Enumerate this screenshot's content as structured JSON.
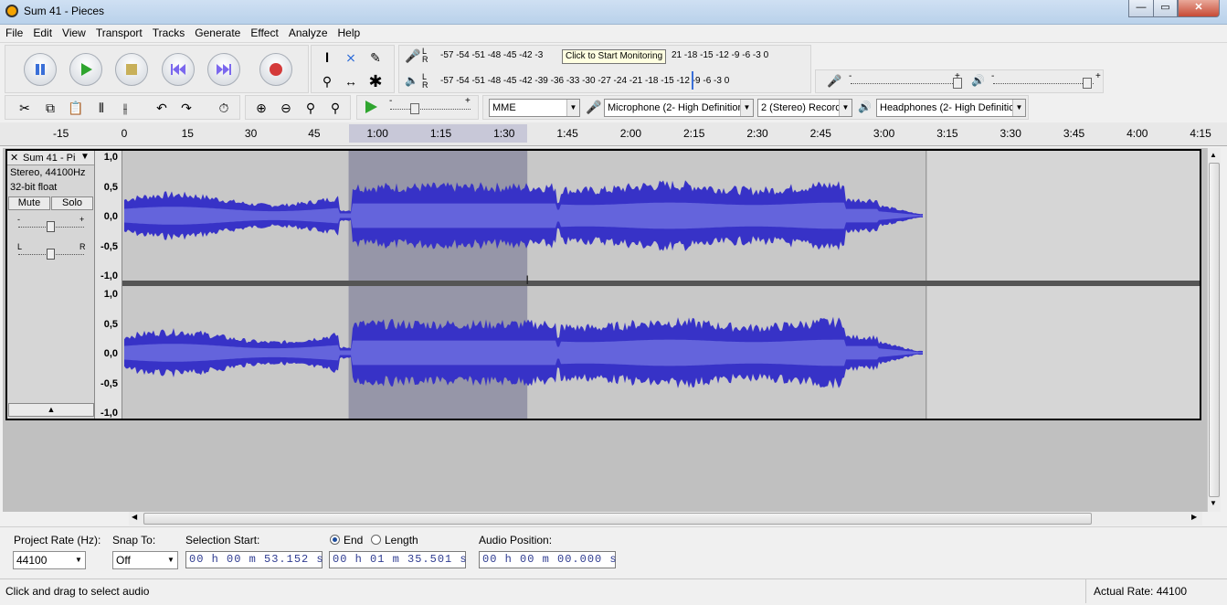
{
  "window": {
    "title": "Sum 41 - Pieces",
    "minimize": "—",
    "maximize": "▭",
    "close": "✕"
  },
  "menu": [
    "File",
    "Edit",
    "View",
    "Transport",
    "Tracks",
    "Generate",
    "Effect",
    "Analyze",
    "Help"
  ],
  "transport_icons": [
    "pause-icon",
    "play-icon",
    "stop-icon",
    "skip-to-start-icon",
    "skip-to-end-icon",
    "record-icon"
  ],
  "meters": {
    "record_scale": "-57 -54 -51 -48 -45 -42 -3",
    "record_scale_tail": "21 -18 -15 -12  -9  -6  -3  0",
    "tooltip": "Click to Start Monitoring",
    "play_scale": "-57 -54 -51 -48 -45 -42 -39 -36 -33 -30 -27 -24 -21 -18 -15 -12  -9  -6  -3  0",
    "L": "L",
    "R": "R"
  },
  "mixer": {
    "record_min": "-",
    "record_max": "+",
    "play_min": "-",
    "play_max": "+"
  },
  "device": {
    "host": "MME",
    "input": "Microphone (2- High Definitior",
    "channels": "2 (Stereo) Recorc",
    "output": "Headphones (2- High Definitic"
  },
  "play_speed": {
    "min": "-",
    "max": "+"
  },
  "ruler_ticks": [
    {
      "label": "-15",
      "v": -15
    },
    {
      "label": "0",
      "v": 0
    },
    {
      "label": "15",
      "v": 15
    },
    {
      "label": "30",
      "v": 30
    },
    {
      "label": "45",
      "v": 45
    },
    {
      "label": "1:00",
      "v": 60
    },
    {
      "label": "1:15",
      "v": 75
    },
    {
      "label": "1:30",
      "v": 90
    },
    {
      "label": "1:45",
      "v": 105
    },
    {
      "label": "2:00",
      "v": 120
    },
    {
      "label": "2:15",
      "v": 135
    },
    {
      "label": "2:30",
      "v": 150
    },
    {
      "label": "2:45",
      "v": 165
    },
    {
      "label": "3:00",
      "v": 180
    },
    {
      "label": "3:15",
      "v": 195
    },
    {
      "label": "3:30",
      "v": 210
    },
    {
      "label": "3:45",
      "v": 225
    },
    {
      "label": "4:00",
      "v": 240
    },
    {
      "label": "4:15",
      "v": 255
    }
  ],
  "track": {
    "name": "Sum 41 - Pi",
    "close": "✕",
    "format": "Stereo, 44100Hz",
    "bits": "32-bit float",
    "mute": "Mute",
    "solo": "Solo",
    "gain_min": "-",
    "gain_max": "+",
    "pan_left": "L",
    "pan_right": "R",
    "collapse": "▲",
    "duration_s": 190,
    "selection_start_s": 53.152,
    "selection_end_s": 95.501,
    "waveform_color": "#3732c7",
    "waveform_rms_color": "#6464dc",
    "selection_color": "#9696a8",
    "background_color": "#d6d6d6"
  },
  "vruler_labels": [
    "1,0",
    "0,5",
    "0,0",
    "-0,5",
    "-1,0"
  ],
  "selection": {
    "project_rate_label": "Project Rate (Hz):",
    "project_rate": "44100",
    "snap_label": "Snap To:",
    "snap": "Off",
    "start_label": "Selection Start:",
    "start_value": "00 h 00 m 53.152 s",
    "end_label": "End",
    "length_label": "Length",
    "end_value": "00 h 01 m 35.501 s",
    "audio_pos_label": "Audio Position:",
    "audio_pos_value": "00 h 00 m 00.000 s"
  },
  "status": {
    "left": "Click and drag to select audio",
    "right": "Actual Rate: 44100"
  }
}
